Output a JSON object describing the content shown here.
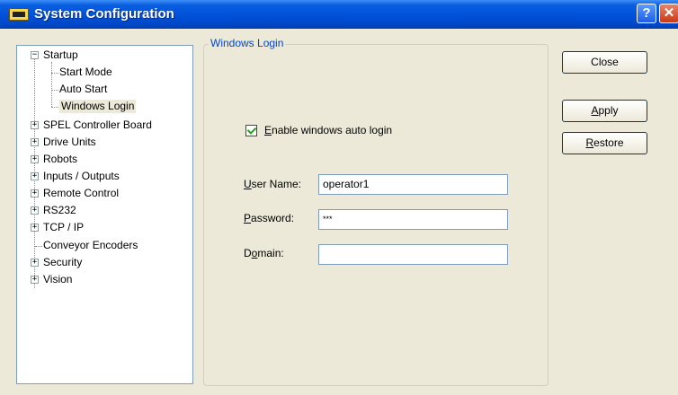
{
  "window": {
    "title": "System Configuration",
    "help_label": "?",
    "close_label": "✕"
  },
  "tree": {
    "items": [
      {
        "label": "Startup",
        "expander": "−"
      },
      {
        "label": "Start Mode"
      },
      {
        "label": "Auto Start"
      },
      {
        "label": "Windows Login",
        "selected": true
      },
      {
        "label": "SPEL Controller Board",
        "expander": "+"
      },
      {
        "label": "Drive Units",
        "expander": "+"
      },
      {
        "label": "Robots",
        "expander": "+"
      },
      {
        "label": "Inputs / Outputs",
        "expander": "+"
      },
      {
        "label": "Remote Control",
        "expander": "+"
      },
      {
        "label": "RS232",
        "expander": "+"
      },
      {
        "label": "TCP / IP",
        "expander": "+"
      },
      {
        "label": "Conveyor Encoders"
      },
      {
        "label": "Security",
        "expander": "+"
      },
      {
        "label": "Vision",
        "expander": "+"
      }
    ]
  },
  "panel": {
    "title": "Windows Login",
    "enable_auto_login": {
      "label_key": "E",
      "label_rest": "nable windows auto login",
      "checked": true
    },
    "user_name": {
      "label_key": "U",
      "label_rest": "ser Name:",
      "value": "operator1"
    },
    "password": {
      "label_key": "P",
      "label_rest": "assword:",
      "value": "***"
    },
    "domain": {
      "label_pre": "D",
      "label_key": "o",
      "label_rest": "main:",
      "value": ""
    }
  },
  "buttons": {
    "close": "Close",
    "apply_key": "A",
    "apply_rest": "pply",
    "restore_key": "R",
    "restore_rest": "estore"
  },
  "colors": {
    "title_bar": "#0050d8",
    "group_title": "#0046d5",
    "window_bg": "#ece9d8",
    "check_mark": "#21a121"
  }
}
